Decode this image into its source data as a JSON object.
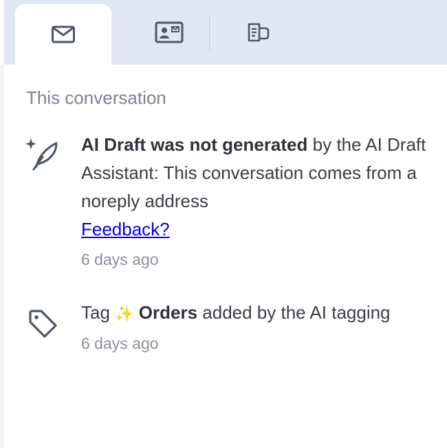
{
  "tabs": [
    {
      "icon": "mail-icon",
      "active": true
    },
    {
      "icon": "contact-card-icon",
      "active": false
    },
    {
      "icon": "order-receipt-icon",
      "active": false
    }
  ],
  "section_title": "This conversation",
  "events": [
    {
      "icon": "ai-quill-icon",
      "bold_text": "AI Draft was not generated",
      "text": " by the AI Draft Assistant: This conversation comes from a noreply address ",
      "link_text": "Feedback?",
      "time": "6 days ago"
    },
    {
      "icon": "tag-icon",
      "prefix": "Tag ",
      "sparkle": "✨",
      "tag_name": "Orders",
      "suffix": " added by the AI tagging",
      "time": "6 days ago"
    }
  ],
  "colors": {
    "tabbar_bg": "#e2e7f4",
    "icon": "#4e5567",
    "link": "#0000ee",
    "muted_text": "#7d8292"
  }
}
